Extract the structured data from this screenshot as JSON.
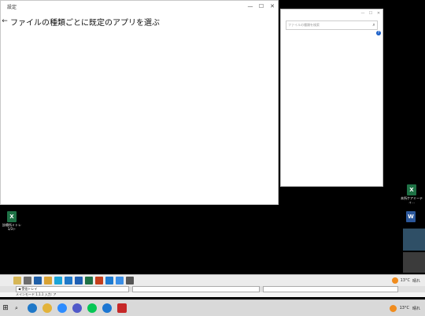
{
  "front_window": {
    "title": "設定",
    "heading": "ファイルの種類ごとに既定のアプリを選ぶ",
    "back_glyph": "←",
    "controls": {
      "minimize": "—",
      "maximize": "☐",
      "close": "✕"
    }
  },
  "back_window": {
    "search_placeholder": "ファイルの種類を検索",
    "search_icon": "search-icon",
    "controls": {
      "minimize": "—",
      "maximize": "☐",
      "close": "✕"
    },
    "help_glyph": "?"
  },
  "desktop_icons": [
    {
      "label": "診療所ミトレ1/3ト",
      "type": "excel",
      "letter": "X"
    },
    {
      "label": "本所ケアミーティ...",
      "type": "excel",
      "letter": "X"
    },
    {
      "label": "W",
      "type": "word",
      "letter": "W"
    }
  ],
  "app_toolbar": {
    "weather_temp": "13°C",
    "weather_text": "晴れ",
    "icon_colors": [
      "#d6b656",
      "#6c6c6c",
      "#1f5fa8",
      "#d9a233",
      "#1aa4d8",
      "#1f78c8",
      "#1e5fb3",
      "#1e7145",
      "#c43e1c",
      "#1e7bd1",
      "#3a8ee6",
      "#555555"
    ]
  },
  "app_status": {
    "field1": "◀ 受信トレイ",
    "line2": "メインモード 1.1.1    入力: ア"
  },
  "taskbar": {
    "start_glyph": "⊞",
    "search_glyph": "⌕",
    "apps": [
      {
        "name": "edge",
        "color": "#1f78c8"
      },
      {
        "name": "chrome",
        "color": "#e3b33a"
      },
      {
        "name": "zoom",
        "color": "#2d8cff"
      },
      {
        "name": "teams",
        "color": "#5059c9"
      },
      {
        "name": "line",
        "color": "#06c755"
      },
      {
        "name": "chat",
        "color": "#1b76d2"
      },
      {
        "name": "pdf",
        "color": "#c62828"
      }
    ],
    "tray_temp": "13°C",
    "tray_weather": "晴れ"
  }
}
